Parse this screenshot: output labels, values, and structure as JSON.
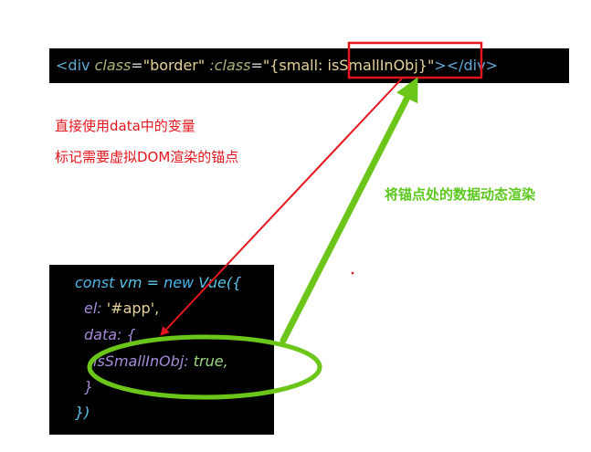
{
  "top_code": {
    "open_bracket": "<",
    "tag": "div",
    "attr1": "class",
    "eq1": "=",
    "val1": "\"border\"",
    "attr2": ":class",
    "eq2": "=",
    "val2": "\"{small: isSmallInObj}\"",
    "close": ">",
    "close_tag_open": "</",
    "close_tag": "div",
    "close_tag_end": ">"
  },
  "bottom_code": {
    "line1_kw1": "const",
    "line1_id": " vm = ",
    "line1_kw2": "new",
    "line1_cls": " Vue({",
    "line2_prop": "el:",
    "line2_val": " '#app',",
    "line3": "data: {",
    "line4_prop": "isSmallInObj:",
    "line4_val": " true,",
    "line5": "}",
    "line6": "})"
  },
  "notes": {
    "red_line1": "直接使用data中的变量",
    "red_line2": "标记需要虚拟DOM渲染的锚点",
    "green": "将锚点处的数据动态渲染"
  },
  "colors": {
    "red": "#e5151d",
    "green": "#6cc61a",
    "code_bg": "#000000"
  }
}
